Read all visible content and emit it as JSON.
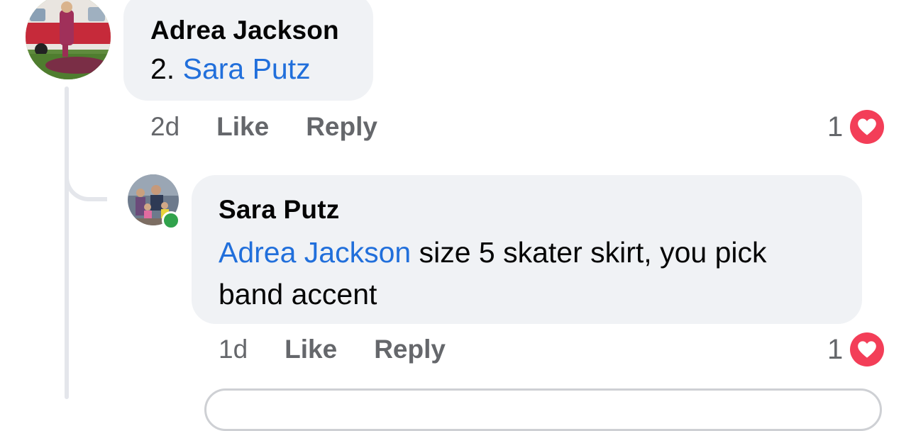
{
  "comments": [
    {
      "author": "Adrea Jackson",
      "text_prefix": "2. ",
      "mention": "Sara Putz",
      "text_suffix": "",
      "time": "2d",
      "like_label": "Like",
      "reply_label": "Reply",
      "reaction_count": "1",
      "reaction_icon": "heart-icon",
      "avatar_icon": "avatar-photo"
    },
    {
      "author": "Sara Putz",
      "text_prefix": "",
      "mention": "Adrea Jackson",
      "text_suffix": " size 5 skater skirt, you pick band accent",
      "time": "1d",
      "like_label": "Like",
      "reply_label": "Reply",
      "reaction_count": "1",
      "reaction_icon": "heart-icon",
      "avatar_icon": "avatar-photo",
      "online": true
    }
  ],
  "colors": {
    "bubble": "#f0f2f5",
    "mention": "#216fdb",
    "secondary_text": "#65676b",
    "heart": "#f33e58",
    "online": "#31a24c"
  }
}
